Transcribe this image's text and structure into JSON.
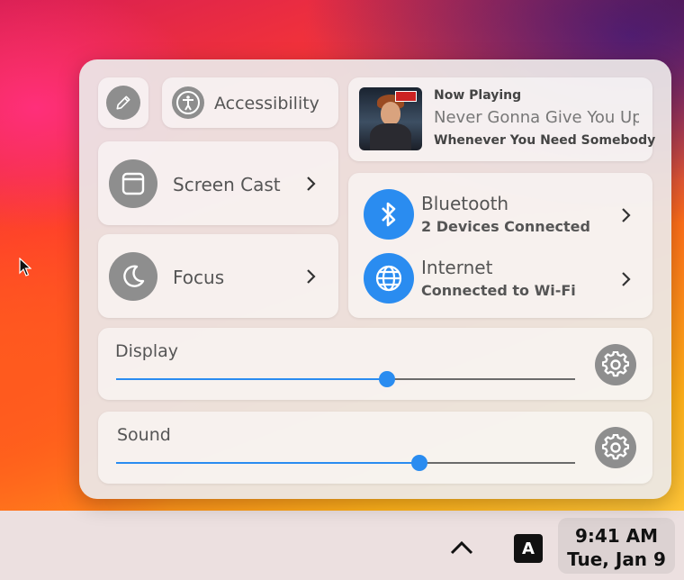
{
  "quick_settings": {
    "edit_icon": "pencil-icon",
    "accessibility_label": "Accessibility",
    "screen_cast_label": "Screen Cast",
    "focus_label": "Focus",
    "now_playing": {
      "header": "Now Playing",
      "title": "Never Gonna Give You Up",
      "album": "Whenever You Need Somebody"
    },
    "bluetooth": {
      "title": "Bluetooth",
      "status": "2 Devices Connected"
    },
    "internet": {
      "title": "Internet",
      "status": "Connected to Wi-Fi"
    },
    "display": {
      "label": "Display",
      "level": 0.59
    },
    "sound": {
      "label": "Sound",
      "level": 0.66
    }
  },
  "taskbar": {
    "input_language": "A",
    "time": "9:41 AM",
    "date": "Tue, Jan 9"
  },
  "colors": {
    "accent": "#2a8cf0",
    "icon_grey": "#8e8e8e",
    "panel_bg": "#ece8e8"
  }
}
